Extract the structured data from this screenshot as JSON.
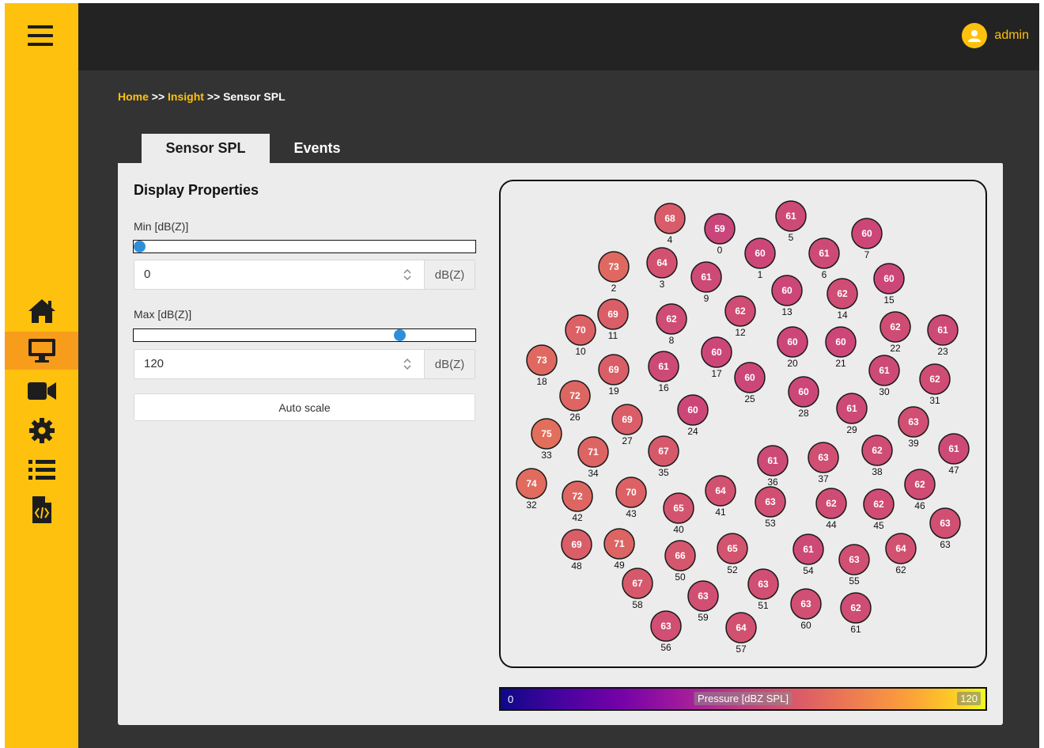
{
  "user": {
    "name": "admin"
  },
  "breadcrumb": {
    "home": "Home",
    "sep": ">>",
    "insight": "Insight",
    "current": "Sensor SPL"
  },
  "tabs": [
    {
      "label": "Sensor SPL",
      "active": true
    },
    {
      "label": "Events",
      "active": false
    }
  ],
  "display_properties": {
    "title": "Display Properties",
    "min": {
      "label": "Min [dB(Z)]",
      "value": "0",
      "unit": "dB(Z)",
      "slider_fraction": 0.0
    },
    "max": {
      "label": "Max [dB(Z)]",
      "value": "120",
      "unit": "dB(Z)",
      "slider_fraction": 0.79
    },
    "auto_scale_label": "Auto scale"
  },
  "sidebar": {
    "items": [
      {
        "icon": "home-icon",
        "active": false
      },
      {
        "icon": "monitor-icon",
        "active": true
      },
      {
        "icon": "video-camera-icon",
        "active": false
      },
      {
        "icon": "gear-icon",
        "active": false
      },
      {
        "icon": "list-icon",
        "active": false
      },
      {
        "icon": "code-file-icon",
        "active": false
      }
    ]
  },
  "colorbar": {
    "min": "0",
    "max": "120",
    "label": "Pressure [dBZ SPL]",
    "colormap": "plasma"
  },
  "sensors": [
    {
      "id": "0",
      "value": "59"
    },
    {
      "id": "1",
      "value": "60"
    },
    {
      "id": "2",
      "value": "73"
    },
    {
      "id": "3",
      "value": "64"
    },
    {
      "id": "4",
      "value": "68"
    },
    {
      "id": "5",
      "value": "61"
    },
    {
      "id": "6",
      "value": "61"
    },
    {
      "id": "7",
      "value": "60"
    },
    {
      "id": "8",
      "value": "62"
    },
    {
      "id": "9",
      "value": "61"
    },
    {
      "id": "10",
      "value": "70"
    },
    {
      "id": "11",
      "value": "69"
    },
    {
      "id": "12",
      "value": "62"
    },
    {
      "id": "13",
      "value": "60"
    },
    {
      "id": "14",
      "value": "62"
    },
    {
      "id": "15",
      "value": "60"
    },
    {
      "id": "16",
      "value": "61"
    },
    {
      "id": "17",
      "value": "60"
    },
    {
      "id": "18",
      "value": "73"
    },
    {
      "id": "19",
      "value": "69"
    },
    {
      "id": "20",
      "value": "60"
    },
    {
      "id": "21",
      "value": "60"
    },
    {
      "id": "22",
      "value": "62"
    },
    {
      "id": "23",
      "value": "61"
    },
    {
      "id": "24",
      "value": "60"
    },
    {
      "id": "25",
      "value": "60"
    },
    {
      "id": "26",
      "value": "72"
    },
    {
      "id": "27",
      "value": "69"
    },
    {
      "id": "28",
      "value": "60"
    },
    {
      "id": "29",
      "value": "61"
    },
    {
      "id": "30",
      "value": "61"
    },
    {
      "id": "31",
      "value": "62"
    },
    {
      "id": "32",
      "value": "74"
    },
    {
      "id": "33",
      "value": "75"
    },
    {
      "id": "34",
      "value": "71"
    },
    {
      "id": "35",
      "value": "67"
    },
    {
      "id": "36",
      "value": "61"
    },
    {
      "id": "37",
      "value": "63"
    },
    {
      "id": "38",
      "value": "62"
    },
    {
      "id": "39",
      "value": "63"
    },
    {
      "id": "40",
      "value": "65"
    },
    {
      "id": "41",
      "value": "64"
    },
    {
      "id": "42",
      "value": "72"
    },
    {
      "id": "43",
      "value": "70"
    },
    {
      "id": "44",
      "value": "62"
    },
    {
      "id": "45",
      "value": "62"
    },
    {
      "id": "46",
      "value": "62"
    },
    {
      "id": "47",
      "value": "61"
    },
    {
      "id": "48",
      "value": "69"
    },
    {
      "id": "49",
      "value": "71"
    },
    {
      "id": "50",
      "value": "66"
    },
    {
      "id": "51",
      "value": "63"
    },
    {
      "id": "52",
      "value": "65"
    },
    {
      "id": "53",
      "value": "63"
    },
    {
      "id": "54",
      "value": "61"
    },
    {
      "id": "55",
      "value": "63"
    },
    {
      "id": "56",
      "value": "63"
    },
    {
      "id": "57",
      "value": "64"
    },
    {
      "id": "58",
      "value": "67"
    },
    {
      "id": "59",
      "value": "63"
    },
    {
      "id": "60",
      "value": "63"
    },
    {
      "id": "61",
      "value": "62"
    },
    {
      "id": "62",
      "value": "64"
    },
    {
      "id": "63",
      "value": "63"
    }
  ]
}
